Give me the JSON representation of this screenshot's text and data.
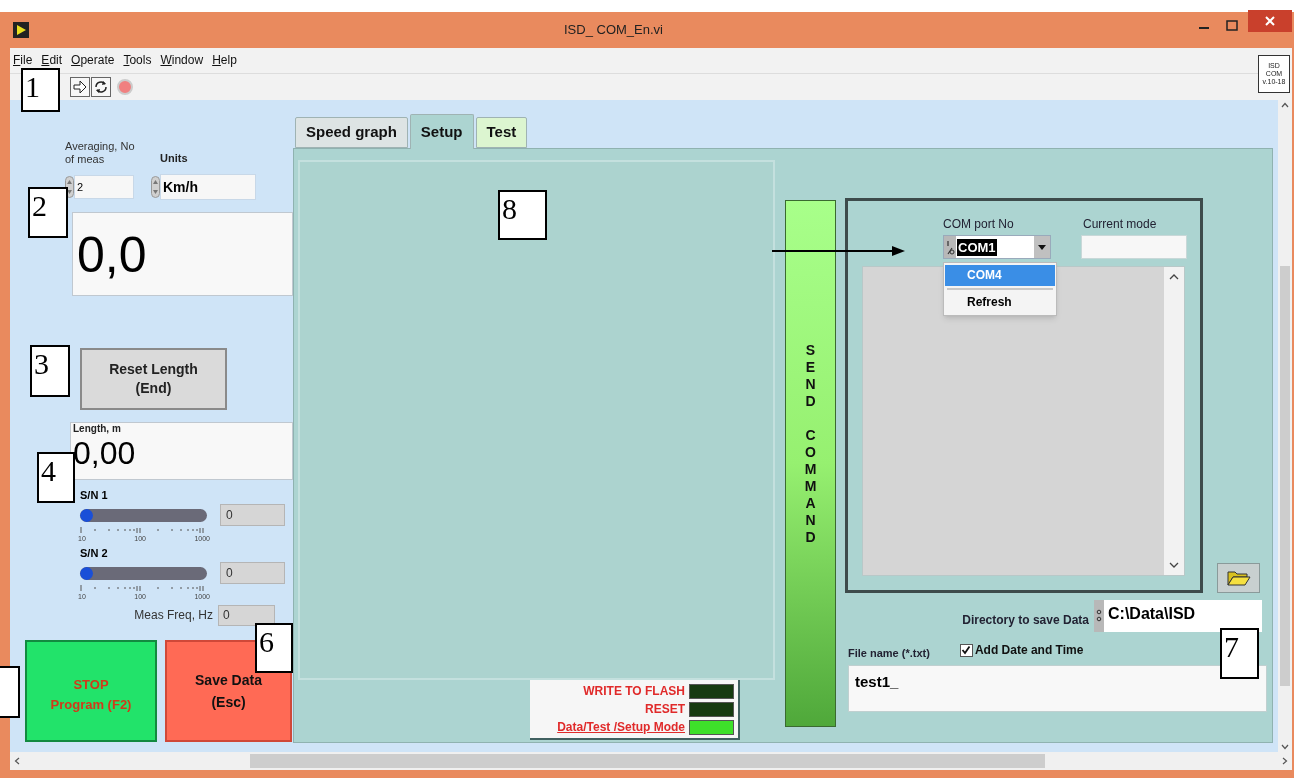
{
  "window": {
    "title": "ISD_ COM_En.vi"
  },
  "menu": [
    {
      "label": "File"
    },
    {
      "label": "Edit"
    },
    {
      "label": "Operate"
    },
    {
      "label": "Tools"
    },
    {
      "label": "Window"
    },
    {
      "label": "Help"
    }
  ],
  "vi_icon": [
    "ISD",
    "COM",
    "v.10-18"
  ],
  "left_panel": {
    "averaging": {
      "label": "Averaging, No of meas",
      "value": "2"
    },
    "units": {
      "label": "Units",
      "value": "Km/h"
    },
    "speed": "0,0",
    "reset_button": [
      "Reset Length",
      "(End)"
    ],
    "length": {
      "label": "Length, m",
      "value": "0,00"
    },
    "sn": [
      {
        "label": "S/N 1",
        "level": 0.04,
        "scale": [
          "10",
          "100",
          "1000"
        ],
        "value": "0"
      },
      {
        "label": "S/N 2",
        "level": 0.04,
        "scale": [
          "10",
          "100",
          "1000"
        ],
        "value": "0"
      }
    ],
    "meas_freq": {
      "label": "Meas Freq, Hz",
      "value": "0"
    },
    "stop_button": [
      "STOP",
      "Program (F2)"
    ],
    "save_button": [
      "Save Data",
      "(Esc)"
    ]
  },
  "tabs": [
    {
      "label": "Speed graph",
      "selected": false,
      "color": "#dde4e4"
    },
    {
      "label": "Setup",
      "selected": true,
      "color": "#acd4d1"
    },
    {
      "label": "Test",
      "selected": false,
      "color": "#dcf5d0"
    }
  ],
  "indicators": [
    {
      "label": "WRITE TO FLASH",
      "on": false,
      "kind": "label"
    },
    {
      "label": "RESET",
      "on": false,
      "kind": "label"
    },
    {
      "label": "Data/Test /Setup Mode",
      "on": true,
      "kind": "title"
    }
  ],
  "send_button": "SEND COMMAND",
  "com_port": {
    "label": "COM port No",
    "value": "COM1",
    "options": [
      {
        "label": "COM4",
        "selected": true
      },
      {
        "label": "Refresh",
        "selected": false
      }
    ]
  },
  "current_mode": {
    "label": "Current mode"
  },
  "directory": {
    "label": "Directory to save Data",
    "value": "C:\\Data\\ISD"
  },
  "file_name": {
    "label": "File name (*.txt)",
    "value": "test1_"
  },
  "add_date": {
    "label": "Add Date and Time",
    "checked": true
  },
  "annotations": [
    {
      "label": "1"
    },
    {
      "label": "2"
    },
    {
      "label": "3"
    },
    {
      "label": "4"
    },
    {
      "label": "6"
    },
    {
      "label": "7"
    },
    {
      "label": "8"
    }
  ]
}
